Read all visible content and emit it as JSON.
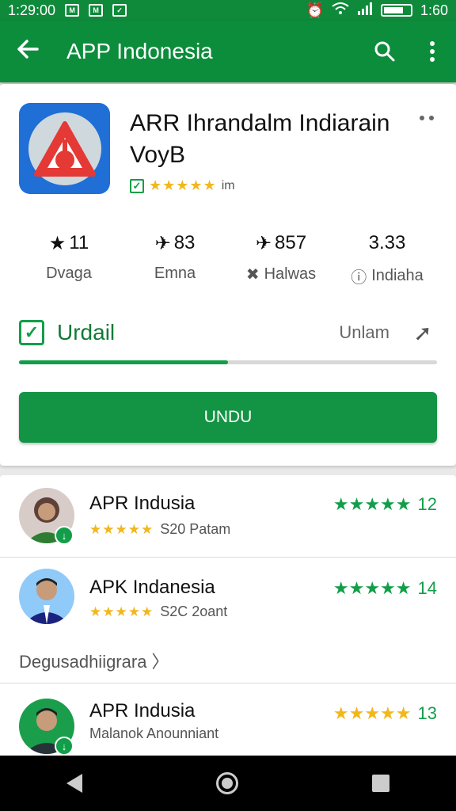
{
  "status_bar": {
    "time_left": "1:29:00",
    "time_right": "1:60"
  },
  "app_bar": {
    "title": "APP Indonesia"
  },
  "app": {
    "name": "ARR Ihrandalm Indiarain VoyB",
    "rating_text": "im",
    "rating_stars": "★★★★★"
  },
  "stats": [
    {
      "value": "11",
      "label": "Dvaga",
      "icon": "star-icon"
    },
    {
      "value": "83",
      "label": "Emna",
      "icon": "plane-icon"
    },
    {
      "value": "857",
      "label": "Halwas",
      "icon": "plane-icon"
    },
    {
      "value": "3.33",
      "label": "Indiaha",
      "icon": "info-icon"
    }
  ],
  "install": {
    "label": "Urdail",
    "status": "Unlam",
    "progress": 0.5,
    "button_label": "UNDU"
  },
  "list": {
    "items": [
      {
        "name": "APR Indusia",
        "sub": "S20 Patam",
        "rating": "12",
        "stars": "★★★★★"
      },
      {
        "name": "APK Indanesia",
        "sub": "S2C 2oant",
        "rating": "14",
        "stars": "★★★★★"
      },
      {
        "name": "APR Indusia",
        "sub": "Malanok Anounniant",
        "rating": "13",
        "stars": "★★★★★"
      }
    ],
    "more_link": "Degusadhiigrara 〉"
  },
  "colors": {
    "primary": "#0c8d3c",
    "accent": "#129e49",
    "star": "#f2b71a"
  }
}
